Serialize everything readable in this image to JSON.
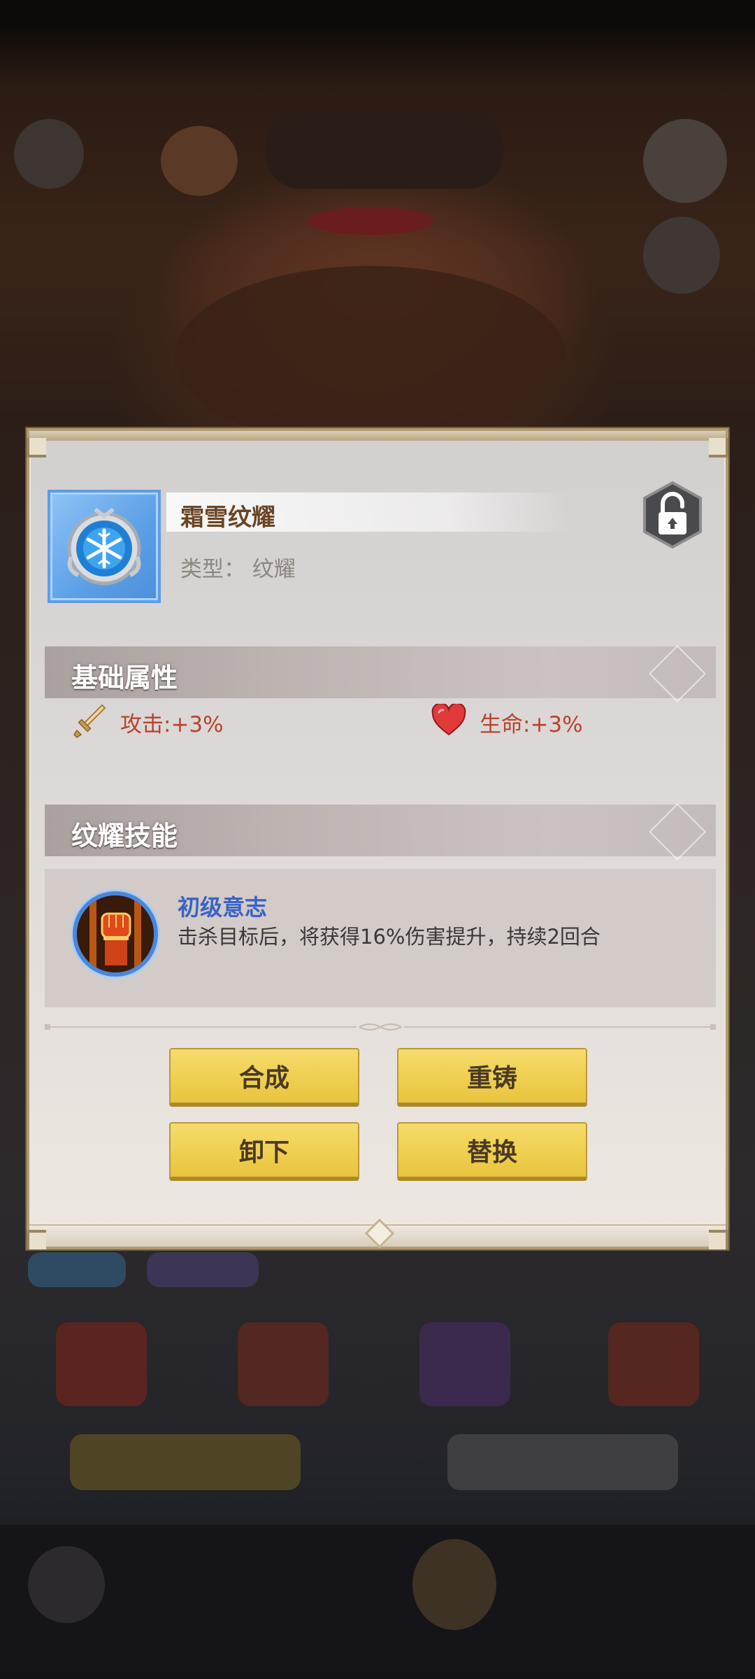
{
  "item": {
    "name": "霜雪纹耀",
    "type_label": "类型： 纹耀",
    "icon": "snowflake-emblem-icon",
    "lock_icon": "unlock-icon"
  },
  "sections": {
    "base_attributes": "基础属性",
    "emblem_skill": "纹耀技能"
  },
  "attributes": [
    {
      "icon": "sword-icon",
      "label": "攻击:+3%"
    },
    {
      "icon": "heart-icon",
      "label": "生命:+3%"
    }
  ],
  "skill": {
    "icon": "fist-icon",
    "name": "初级意志",
    "description": "击杀目标后，将获得16%伤害提升，持续2回合"
  },
  "buttons": {
    "combine": "合成",
    "recast": "重铸",
    "unequip": "卸下",
    "replace": "替换"
  },
  "colors": {
    "button_yellow": "#efcf4f",
    "attribute_red": "#b6432d",
    "skill_blue": "#3a63c5",
    "item_frame_blue": "#5f9be8"
  }
}
